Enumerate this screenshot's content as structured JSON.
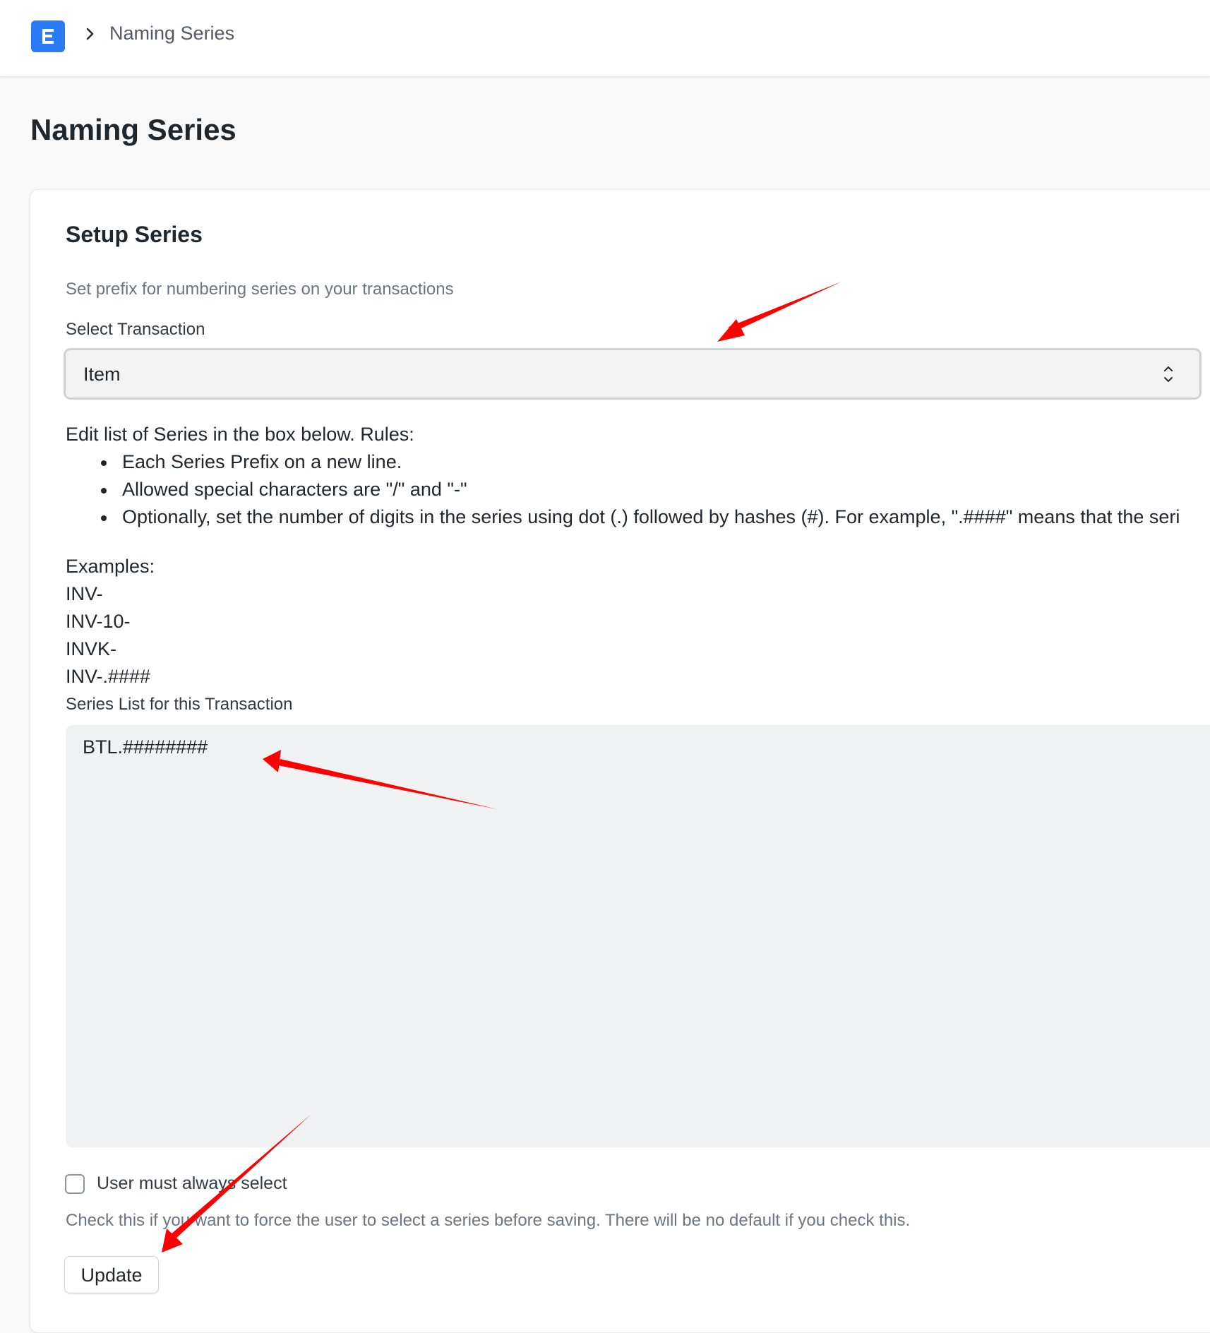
{
  "navbar": {
    "logo_letter": "E",
    "breadcrumb": "Naming Series"
  },
  "page": {
    "title": "Naming Series"
  },
  "setup": {
    "section_title": "Setup Series",
    "description": "Set prefix for numbering series on your transactions",
    "select_label": "Select Transaction",
    "select_value": "Item",
    "rules_intro": "Edit list of Series in the box below. Rules:",
    "rules": [
      "Each Series Prefix on a new line.",
      "Allowed special characters are \"/\" and \"-\"",
      "Optionally, set the number of digits in the series using dot (.) followed by hashes (#). For example, \".####\" means that the seri"
    ],
    "examples_label": "Examples:",
    "examples": [
      "INV-",
      "INV-10-",
      "INVK-",
      "INV-.####"
    ],
    "series_label": "Series List for this Transaction",
    "series_value": "BTL.########",
    "checkbox_label": "User must always select",
    "checkbox_checked": false,
    "help_text": "Check this if you want to force the user to select a series before saving. There will be no default if you check this.",
    "update_label": "Update"
  },
  "colors": {
    "brand": "#2a7cf6",
    "annotation_arrow": "#ff0000"
  }
}
